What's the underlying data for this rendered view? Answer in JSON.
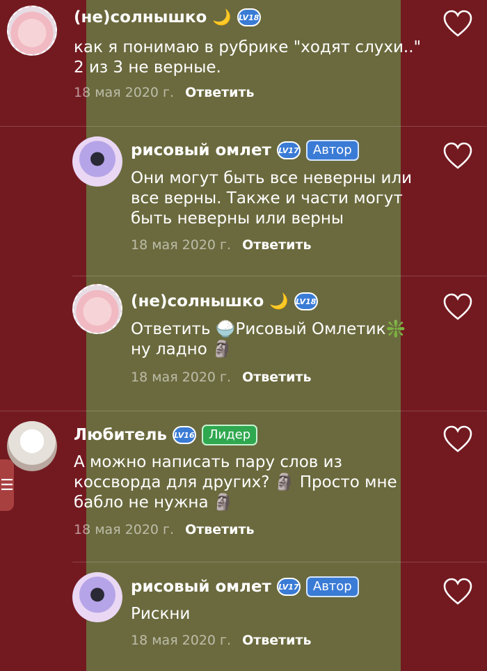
{
  "comments": [
    {
      "author": "(не)солнышко",
      "level": "LV18",
      "badge": "",
      "lines": [
        "как я понимаю в рубрике \"ходят слухи..\"",
        "2 из 3 не верные."
      ],
      "date": "18 мая 2020 г.",
      "reply": "Ответить"
    },
    {
      "author": "рисовый омлет",
      "level": "LV17",
      "badge": "Автор",
      "lines": [
        "Они могут быть все неверны или",
        "все верны. Также и части могут",
        "быть неверны или верны"
      ],
      "date": "18 мая 2020 г.",
      "reply": "Ответить"
    },
    {
      "author": "(не)солнышко",
      "level": "LV18",
      "badge": "",
      "lines": [
        "Ответить 🍚Рисовый Омлетик❇️",
        "ну ладно 🗿"
      ],
      "date": "18 мая 2020 г.",
      "reply": "Ответить"
    },
    {
      "author": "Любитель",
      "level": "LV16",
      "badge": "Лидер",
      "lines": [
        "А можно написать пару слов из",
        "коссворда для других? 🗿 Просто мне",
        "бабло не нужна 🗿"
      ],
      "date": "18 мая 2020 г.",
      "reply": "Ответить"
    },
    {
      "author": "рисовый омлет",
      "level": "LV17",
      "badge": "Автор",
      "lines": [
        "Рискни"
      ],
      "date": "18 мая 2020 г.",
      "reply": "Ответить"
    }
  ],
  "side_handle": "☰",
  "icons": {
    "moon": "🌙",
    "heart": "heart-icon"
  },
  "colors": {
    "background": "#731a20",
    "stripe": "#6b6a3e",
    "level_badge": "#3a7bd5",
    "author_badge": "#3a7bd5",
    "leader_badge": "#2fa84f"
  }
}
